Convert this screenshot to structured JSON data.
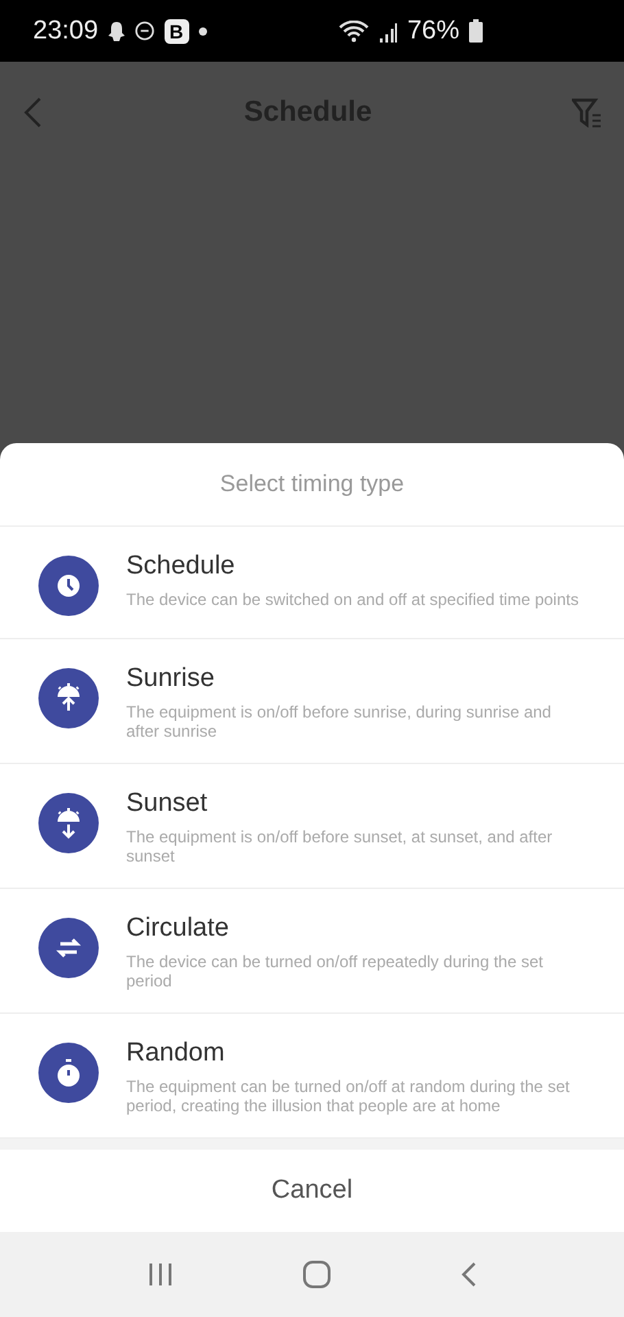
{
  "status_bar": {
    "time": "23:09",
    "badge": "B",
    "battery": "76%"
  },
  "app_bar": {
    "title": "Schedule"
  },
  "sheet": {
    "title": "Select timing type",
    "options": [
      {
        "kind": "schedule",
        "title": "Schedule",
        "description": "The device can be switched on and off at specified time points"
      },
      {
        "kind": "sunrise",
        "title": "Sunrise",
        "description": "The equipment is on/off before sunrise, during sunrise and after sunrise"
      },
      {
        "kind": "sunset",
        "title": "Sunset",
        "description": "The equipment is on/off before sunset, at sunset, and after sunset"
      },
      {
        "kind": "circulate",
        "title": "Circulate",
        "description": "The device can be turned on/off repeatedly during the set period"
      },
      {
        "kind": "random",
        "title": "Random",
        "description": "The equipment can be turned on/off at random during the set period, creating the illusion that people are at home"
      }
    ],
    "cancel": "Cancel"
  }
}
